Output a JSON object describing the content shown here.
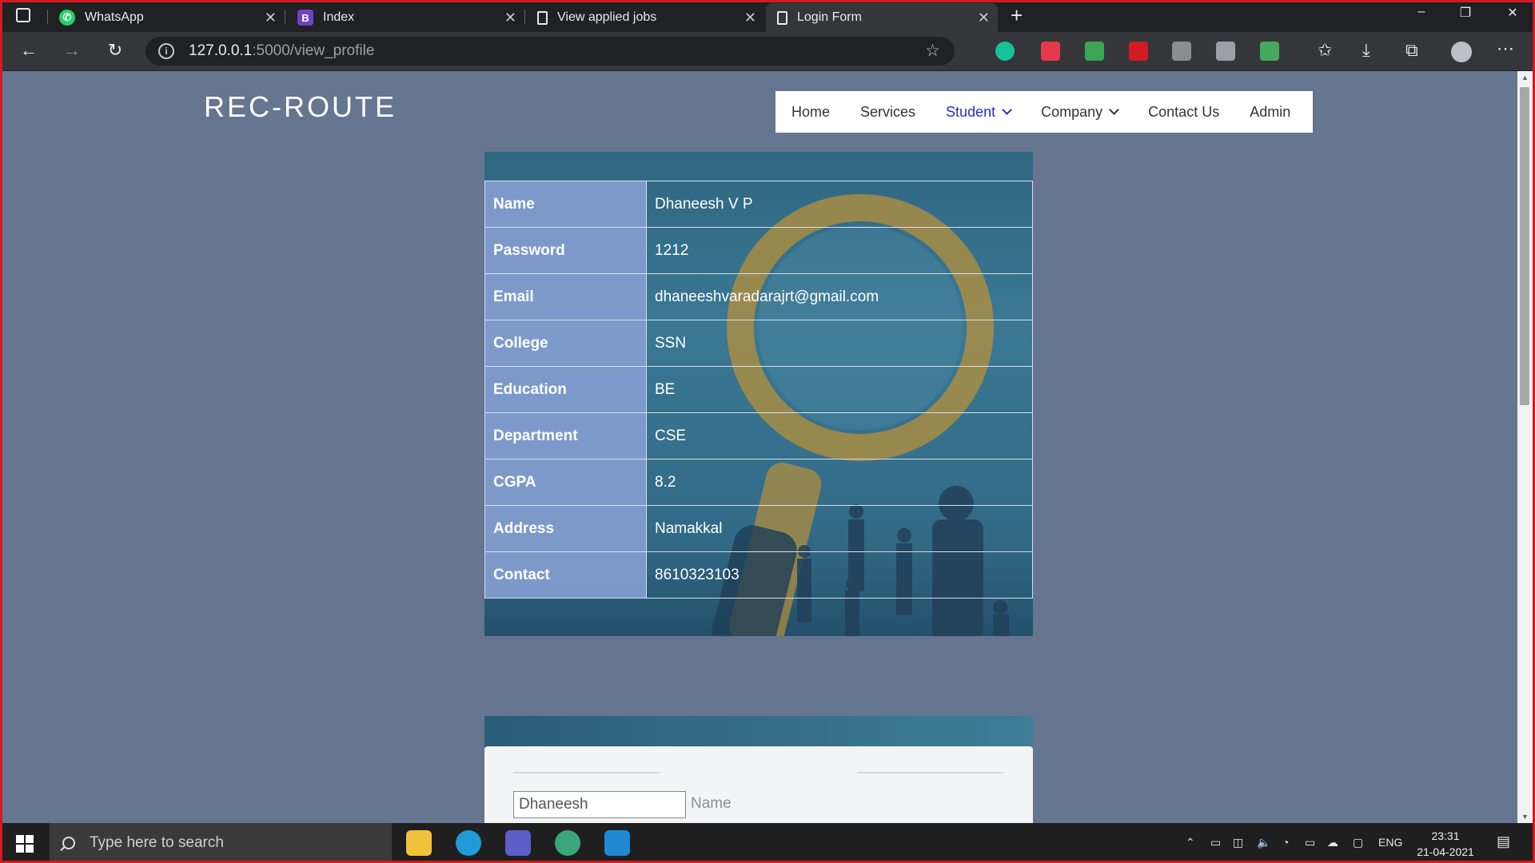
{
  "browser": {
    "tabs": [
      {
        "label": "WhatsApp",
        "icon": "whatsapp-icon"
      },
      {
        "label": "Index",
        "icon": "bootstrap-icon"
      },
      {
        "label": "View applied jobs",
        "icon": "page-icon"
      },
      {
        "label": "Login Form",
        "icon": "page-icon",
        "active": true
      }
    ],
    "url_host": "127.0.0.1",
    "url_path": ":5000/view_profile"
  },
  "site": {
    "brand": "REC-ROUTE",
    "nav": {
      "home": "Home",
      "services": "Services",
      "student": "Student",
      "company": "Company",
      "contact": "Contact Us",
      "admin": "Admin"
    },
    "active_nav": "Student",
    "accent_color": "#2230c8"
  },
  "profile": {
    "rows": [
      {
        "label": "Name",
        "value": "Dhaneesh V P"
      },
      {
        "label": "Password",
        "value": "1212"
      },
      {
        "label": "Email",
        "value": "dhaneeshvaradarajrt@gmail.com"
      },
      {
        "label": "College",
        "value": "SSN"
      },
      {
        "label": "Education",
        "value": "BE"
      },
      {
        "label": "Department",
        "value": "CSE"
      },
      {
        "label": "CGPA",
        "value": "8.2"
      },
      {
        "label": "Address",
        "value": "Namakkal"
      },
      {
        "label": "Contact",
        "value": "8610323103"
      }
    ]
  },
  "edit_form": {
    "name_value": "Dhaneesh",
    "name_label": "Name"
  },
  "taskbar": {
    "search_placeholder": "Type here to search",
    "language": "ENG",
    "time": "23:31",
    "date": "21-04-2021"
  }
}
